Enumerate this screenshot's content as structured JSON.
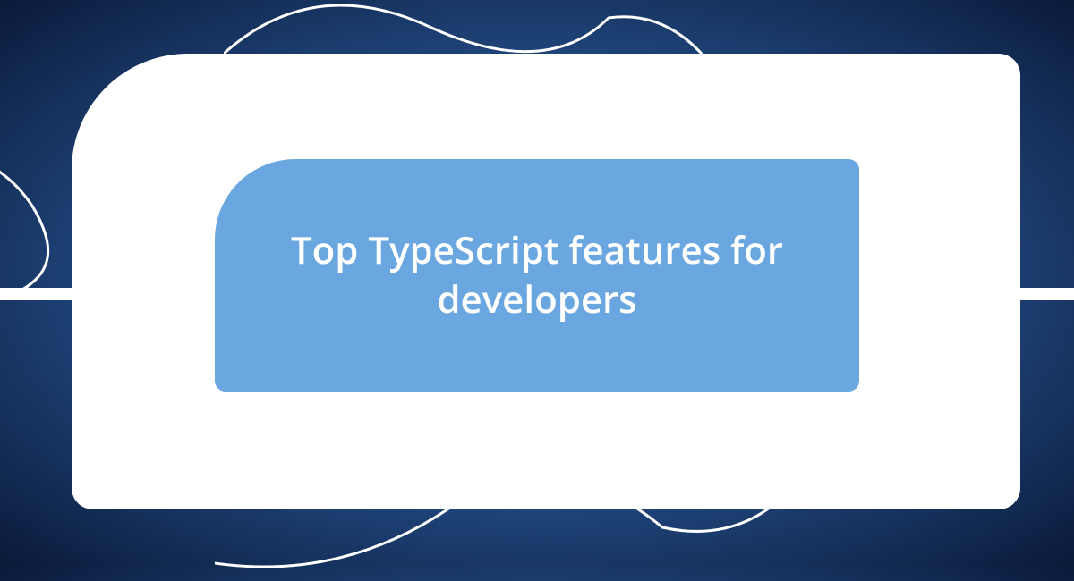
{
  "title": "Top TypeScript features for developers",
  "colors": {
    "accent": "#6aa7e0",
    "card": "#ffffff",
    "text": "#ffffff"
  }
}
